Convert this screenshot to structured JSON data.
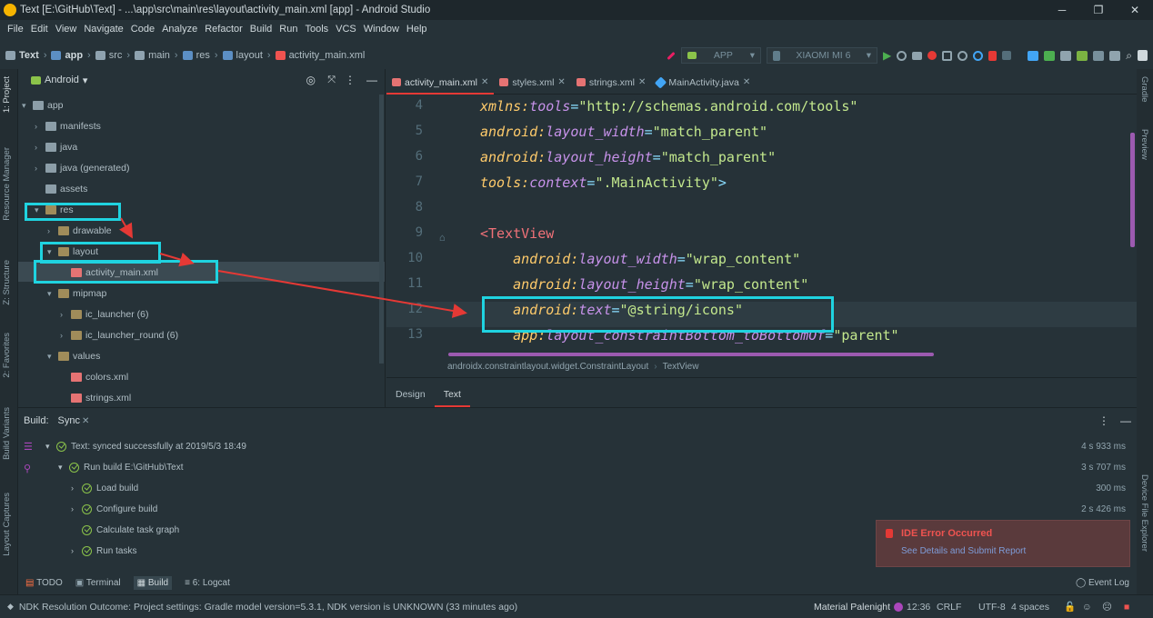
{
  "titlebar": {
    "title": "Text [E:\\GitHub\\Text] - ...\\app\\src\\main\\res\\layout\\activity_main.xml [app] - Android Studio",
    "minimize": "─",
    "maximize": "❐",
    "close": "✕"
  },
  "menu": [
    "File",
    "Edit",
    "View",
    "Navigate",
    "Code",
    "Analyze",
    "Refactor",
    "Build",
    "Run",
    "Tools",
    "VCS",
    "Window",
    "Help"
  ],
  "breadcrumb": [
    "Text",
    "app",
    "src",
    "main",
    "res",
    "layout",
    "activity_main.xml"
  ],
  "run_config": {
    "module": "APP",
    "device": "XIAOMI MI 6"
  },
  "left_stripe_tabs": [
    "1: Project",
    "Resource Manager",
    "Z: Structure",
    "2: Favorites",
    "Build Variants",
    "Layout Captures"
  ],
  "right_stripe_tabs": [
    "Gradle",
    "Preview",
    "Device File Explorer"
  ],
  "project": {
    "view": "Android",
    "tree": [
      {
        "label": "app",
        "level": 0
      },
      {
        "label": "manifests",
        "level": 1
      },
      {
        "label": "java",
        "level": 1
      },
      {
        "label": "java (generated)",
        "level": 1
      },
      {
        "label": "assets",
        "level": 1
      },
      {
        "label": "res",
        "level": 1
      },
      {
        "label": "drawable",
        "level": 2
      },
      {
        "label": "layout",
        "level": 2
      },
      {
        "label": "activity_main.xml",
        "level": 3
      },
      {
        "label": "mipmap",
        "level": 2
      },
      {
        "label": "ic_launcher (6)",
        "level": 3
      },
      {
        "label": "ic_launcher_round (6)",
        "level": 3
      },
      {
        "label": "values",
        "level": 2
      },
      {
        "label": "colors.xml",
        "level": 3
      },
      {
        "label": "strings.xml",
        "level": 3
      }
    ]
  },
  "editor_tabs": [
    {
      "label": "activity_main.xml",
      "active": true
    },
    {
      "label": "styles.xml",
      "active": false
    },
    {
      "label": "strings.xml",
      "active": false
    },
    {
      "label": "MainActivity.java",
      "active": false
    }
  ],
  "code": {
    "line_numbers": [
      "4",
      "5",
      "6",
      "7",
      "8",
      "9",
      "10",
      "11",
      "12",
      "13"
    ],
    "lines": [
      {
        "ns": "xmlns",
        "attr": "tools",
        "val": "\"http://schemas.android.com/tools\"",
        "indent": "",
        "tail": ""
      },
      {
        "ns": "android",
        "attr": "layout_width",
        "val": "\"match_parent\"",
        "indent": "",
        "tail": ""
      },
      {
        "ns": "android",
        "attr": "layout_height",
        "val": "\"match_parent\"",
        "indent": "",
        "tail": ""
      },
      {
        "ns": "tools",
        "attr": "context",
        "val": "\".MainActivity\"",
        "indent": "",
        "tail": ">"
      },
      {
        "ns": "",
        "attr": "",
        "val": "",
        "indent": "",
        "tail": ""
      },
      {
        "tag": "<TextView"
      },
      {
        "ns": "android",
        "attr": "layout_width",
        "val": "\"wrap_content\"",
        "indent": "    ",
        "tail": ""
      },
      {
        "ns": "android",
        "attr": "layout_height",
        "val": "\"wrap_content\"",
        "indent": "    ",
        "tail": ""
      },
      {
        "ns": "android",
        "attr": "text",
        "val": "\"@string/icons\"",
        "indent": "    ",
        "tail": ""
      },
      {
        "ns": "app",
        "attr": "layout_constraintBottom_toBottomOf",
        "val": "\"parent\"",
        "indent": "    ",
        "tail": ""
      }
    ]
  },
  "xml_breadcrumb": [
    "androidx.constraintlayout.widget.ConstraintLayout",
    "TextView"
  ],
  "design_tabs": [
    {
      "label": "Design",
      "active": false
    },
    {
      "label": "Text",
      "active": true
    }
  ],
  "build": {
    "tabs": [
      "Build:",
      "Sync"
    ],
    "rows": [
      {
        "label": "Text: synced successfully at 2019/5/3 18:49",
        "time": "4 s 933 ms",
        "level": 0
      },
      {
        "label": "Run build E:\\GitHub\\Text",
        "time": "3 s 707 ms",
        "level": 1
      },
      {
        "label": "Load build",
        "time": "300 ms",
        "level": 2
      },
      {
        "label": "Configure build",
        "time": "2 s 426 ms",
        "level": 2
      },
      {
        "label": "Calculate task graph",
        "time": "",
        "level": 2
      },
      {
        "label": "Run tasks",
        "time": "",
        "level": 2
      }
    ]
  },
  "error_popup": {
    "title": "IDE Error Occurred",
    "link": "See Details and Submit Report"
  },
  "bottom_tools": [
    "TODO",
    "Terminal",
    "Build",
    "6: Logcat"
  ],
  "event_log": "Event Log",
  "status": {
    "message": "NDK Resolution Outcome: Project settings: Gradle model version=5.3.1, NDK version is UNKNOWN (33 minutes ago)",
    "theme": "Material Palenight",
    "position": "12:36",
    "line_sep": "CRLF",
    "encoding": "UTF-8",
    "indent": "4 spaces"
  },
  "colors": {
    "highlight": "#1fd3e0",
    "arrow": "#e53935",
    "accent": "#e53935"
  }
}
